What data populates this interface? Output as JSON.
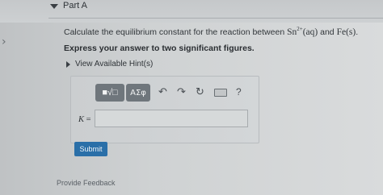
{
  "part": {
    "title": "Part A"
  },
  "question": {
    "prefix": "Calculate the equilibrium constant for the reaction between ",
    "species1": "Sn",
    "charge": "2+",
    "state1": "(aq)",
    "connector": " and ",
    "species2": "Fe(s)",
    "suffix": "."
  },
  "instruction": "Express your answer to two significant figures.",
  "hints": {
    "label": "View Available Hint(s)"
  },
  "toolbar": {
    "templates_label": "■√□",
    "symbols_label": "ΑΣφ",
    "undo_icon": "undo-icon",
    "redo_icon": "redo-icon",
    "reset_icon": "reset-icon",
    "keyboard_icon": "keyboard-icon",
    "help_label": "?"
  },
  "answer": {
    "variable": "K",
    "equals": " =",
    "value": ""
  },
  "submit": {
    "label": "Submit"
  },
  "footer": {
    "feedback_label": "Provide Feedback"
  }
}
